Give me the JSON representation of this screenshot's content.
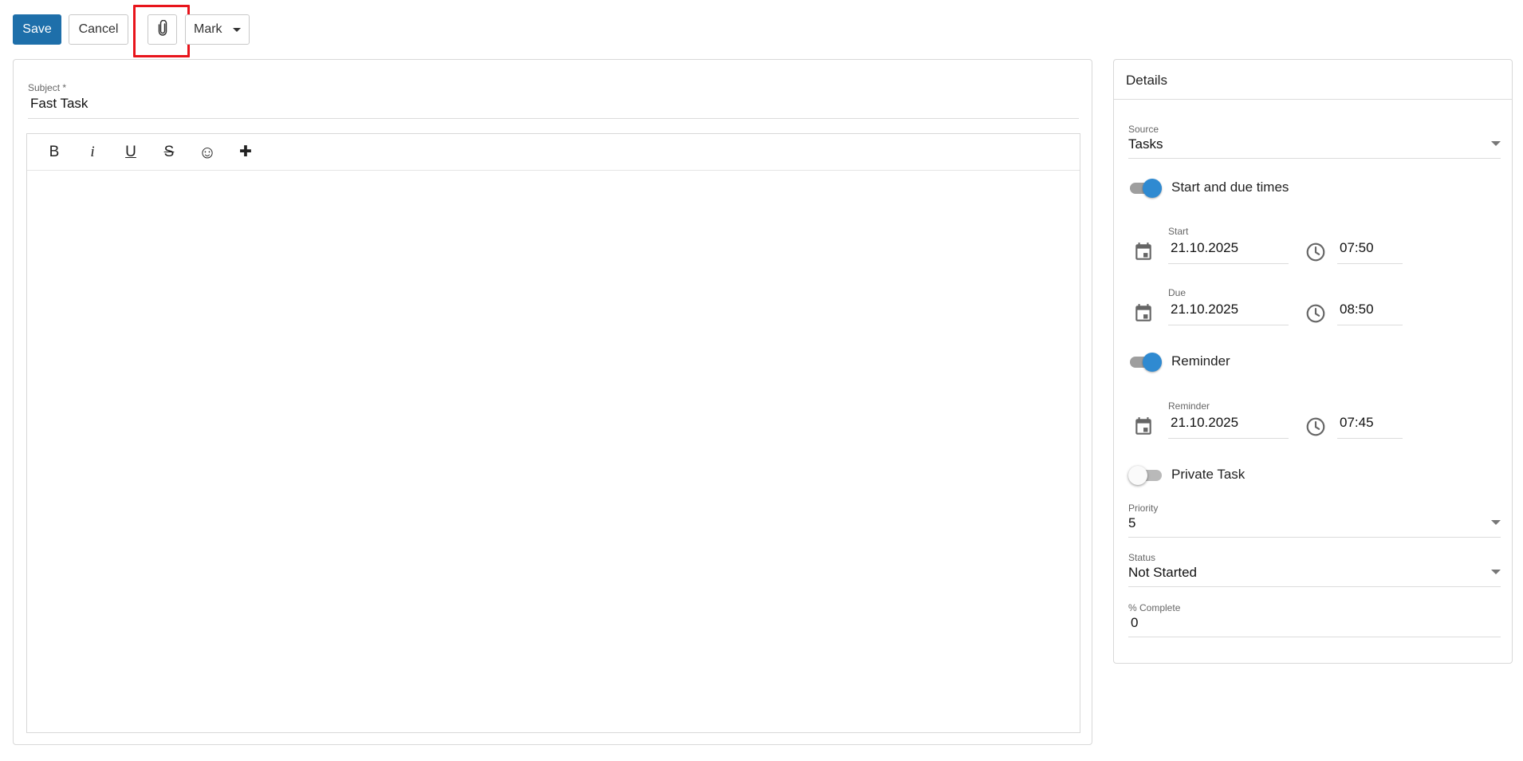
{
  "toolbar": {
    "save_label": "Save",
    "cancel_label": "Cancel",
    "mark_label": "Mark",
    "attach_icon": "paperclip-icon",
    "highlight_color": "#e8141b",
    "primary_color": "#1e6faa"
  },
  "editor": {
    "subject_label": "Subject *",
    "subject_value": "Fast Task",
    "format_buttons": {
      "bold": "B",
      "italic": "i",
      "underline": "U",
      "strike": "S",
      "emoji": "☺",
      "insert": "✚"
    },
    "body": ""
  },
  "details": {
    "title": "Details",
    "source": {
      "label": "Source",
      "value": "Tasks"
    },
    "start_due_toggle": {
      "label": "Start and due times",
      "on": true
    },
    "start": {
      "label": "Start",
      "date": "21.10.2025",
      "time": "07:50"
    },
    "due": {
      "label": "Due",
      "date": "21.10.2025",
      "time": "08:50"
    },
    "reminder_toggle": {
      "label": "Reminder",
      "on": true
    },
    "reminder": {
      "label": "Reminder",
      "date": "21.10.2025",
      "time": "07:45"
    },
    "private_toggle": {
      "label": "Private Task",
      "on": false
    },
    "priority": {
      "label": "Priority",
      "value": "5"
    },
    "status": {
      "label": "Status",
      "value": "Not Started"
    },
    "percent_complete": {
      "label": "% Complete",
      "value": "0"
    },
    "toggle_on_color": "#2f8ad1"
  }
}
